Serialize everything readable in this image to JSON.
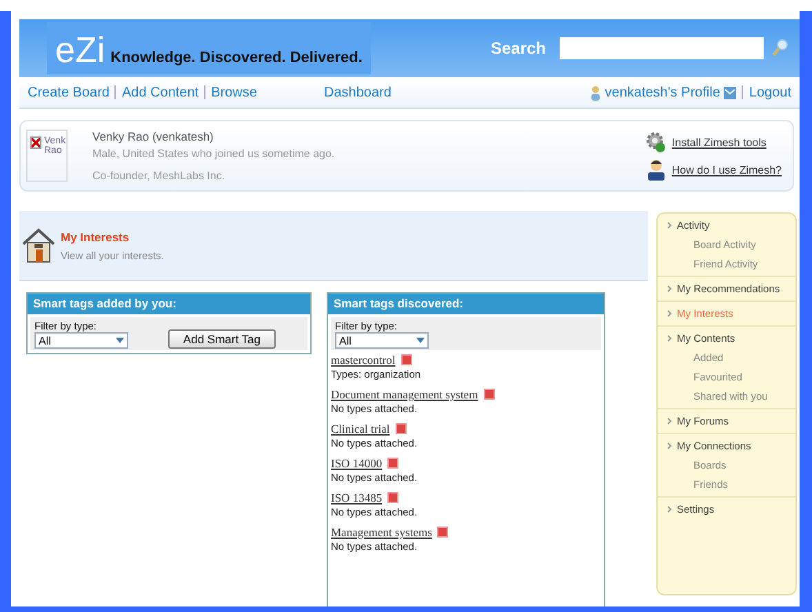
{
  "header": {
    "logo": "eZi",
    "tagline": "Knowledge. Discovered. Delivered.",
    "search_label": "Search"
  },
  "nav": {
    "left_links": [
      "Create Board",
      "Add Content",
      "Browse"
    ],
    "center_link": "Dashboard",
    "profile_link": "venkatesh's Profile",
    "logout": "Logout"
  },
  "profile": {
    "avatar_alt": "Venk Rao",
    "name": "Venky Rao (venkatesh)",
    "details": "Male, United States who joined us sometime ago.",
    "role": "Co-founder, MeshLabs Inc.",
    "links": [
      "Install Zimesh tools",
      "How do I use Zimesh?"
    ]
  },
  "interests": {
    "title": "My Interests",
    "subtitle": "View all your interests."
  },
  "added_panel": {
    "title": "Smart tags added by you:",
    "filter_label": "Filter by type:",
    "filter_value": "All",
    "button": "Add Smart Tag"
  },
  "discovered_panel": {
    "title": "Smart tags discovered:",
    "filter_label": "Filter by type:",
    "filter_value": "All",
    "tags": [
      {
        "name": "mastercontrol",
        "types": "Types: organization"
      },
      {
        "name": "Document management system",
        "types": "No types attached."
      },
      {
        "name": "Clinical trial",
        "types": "No types attached."
      },
      {
        "name": "ISO 14000",
        "types": "No types attached."
      },
      {
        "name": "ISO 13485",
        "types": "No types attached."
      },
      {
        "name": "Management systems",
        "types": "No types attached."
      }
    ]
  },
  "sidebar": {
    "items": [
      {
        "label": "Activity",
        "selected": false,
        "children": [
          {
            "label": "Board Activity"
          },
          {
            "label": "Friend Activity"
          }
        ]
      },
      {
        "label": "My Recommendations",
        "selected": false
      },
      {
        "label": "My Interests",
        "selected": true
      },
      {
        "label": "My Contents",
        "selected": false,
        "children": [
          {
            "label": "Added"
          },
          {
            "label": "Favourited"
          },
          {
            "label": "Shared with you"
          }
        ]
      },
      {
        "label": "My Forums",
        "selected": false
      },
      {
        "label": "My Connections",
        "selected": false,
        "children": [
          {
            "label": "Boards"
          },
          {
            "label": "Friends"
          }
        ]
      },
      {
        "label": "Settings",
        "selected": false
      }
    ]
  }
}
